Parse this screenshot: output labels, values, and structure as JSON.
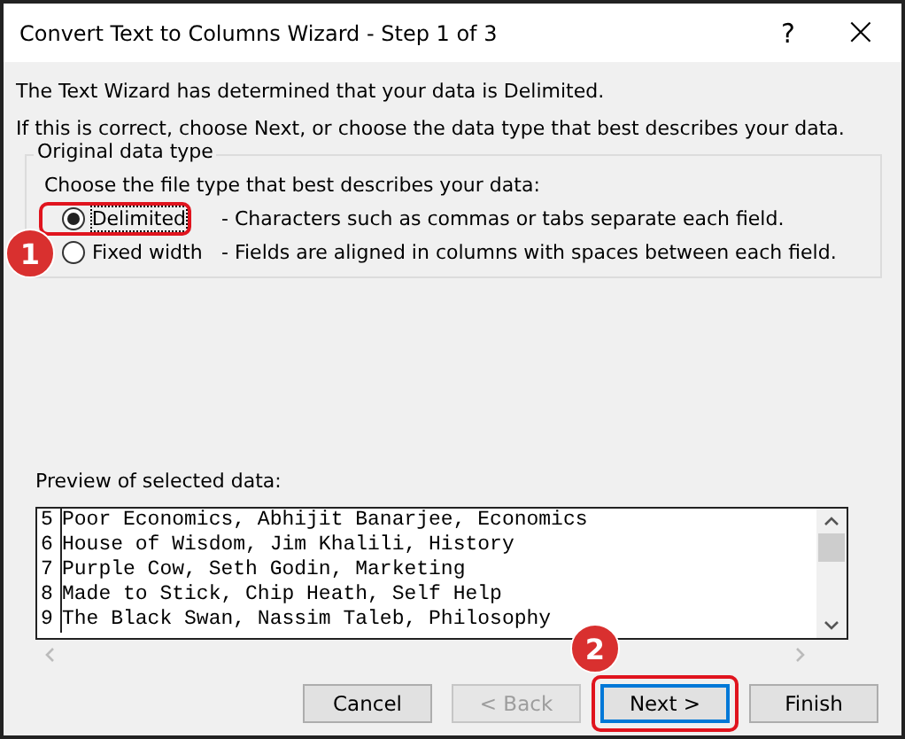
{
  "window": {
    "title": "Convert Text to Columns Wizard - Step 1 of 3",
    "help": "?",
    "close": "×"
  },
  "intro": [
    "The Text Wizard has determined that your data is Delimited.",
    "If this is correct, choose Next, or choose the data type that best describes your data."
  ],
  "group": {
    "title": "Original data type",
    "prompt": "Choose the file type that best describes your data:",
    "options": [
      {
        "label": "Delimited",
        "description": "- Characters such as commas or tabs separate each field.",
        "selected": true,
        "highlighted": true
      },
      {
        "label": "Fixed width",
        "description": "- Fields are aligned in columns with spaces between each field.",
        "selected": false,
        "highlighted": false,
        "badge": "1"
      }
    ]
  },
  "preview": {
    "label": "Preview of selected data:",
    "rows": [
      {
        "number": "5",
        "text": "Poor Economics, Abhijit Banarjee, Economics"
      },
      {
        "number": "6",
        "text": "House of Wisdom, Jim Khalili, History"
      },
      {
        "number": "7",
        "text": "Purple Cow, Seth Godin, Marketing"
      },
      {
        "number": "8",
        "text": "Made to Stick, Chip Heath, Self Help"
      },
      {
        "number": "9",
        "text": "The Black Swan, Nassim Taleb, Philosophy"
      }
    ]
  },
  "buttons": [
    {
      "label": "Cancel",
      "disabled": false,
      "default": false,
      "highlighted": false
    },
    {
      "label": "< Back",
      "disabled": true,
      "default": false,
      "highlighted": false
    },
    {
      "label": "Next >",
      "disabled": false,
      "default": true,
      "highlighted": true,
      "badge": "2"
    },
    {
      "label": "Finish",
      "disabled": false,
      "default": false,
      "highlighted": false
    }
  ]
}
